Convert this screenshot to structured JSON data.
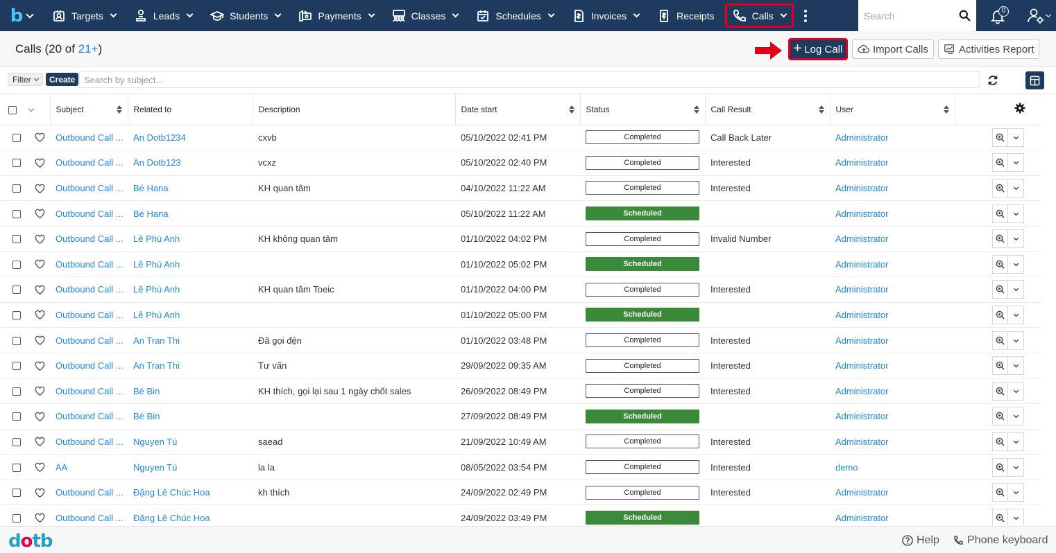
{
  "nav": {
    "items": [
      {
        "label": "Targets",
        "icon": "target-id-icon",
        "caret": true
      },
      {
        "label": "Leads",
        "icon": "leads-person-icon",
        "caret": true
      },
      {
        "label": "Students",
        "icon": "graduation-cap-icon",
        "caret": true
      },
      {
        "label": "Payments",
        "icon": "payment-icon",
        "caret": true
      },
      {
        "label": "Classes",
        "icon": "classes-icon",
        "caret": true
      },
      {
        "label": "Schedules",
        "icon": "calendar-check-icon",
        "caret": true
      },
      {
        "label": "Invoices",
        "icon": "invoice-icon",
        "caret": true
      },
      {
        "label": "Receipts",
        "icon": "receipt-icon",
        "caret": false
      },
      {
        "label": "Calls",
        "icon": "phone-icon",
        "caret": true,
        "active": true
      }
    ],
    "search_placeholder": "Search",
    "notification_count": "0"
  },
  "header": {
    "title_prefix": "Calls (20 of ",
    "title_count": "21+",
    "title_suffix": ")",
    "log_call_label": "Log Call",
    "import_calls_label": "Import Calls",
    "activities_report_label": "Activities Report"
  },
  "filter": {
    "filter_label": "Filter",
    "create_label": "Create",
    "search_placeholder": "Search by subject..."
  },
  "columns": [
    "Subject",
    "Related to",
    "Description",
    "Date start",
    "Status",
    "Call Result",
    "User"
  ],
  "rows": [
    {
      "subject": "Outbound Call ...",
      "related": "An Dotb1234",
      "description": "cxvb",
      "date": "05/10/2022 02:41 PM",
      "status": "Completed",
      "result": "Call Back Later",
      "user": "Administrator"
    },
    {
      "subject": "Outbound Call ...",
      "related": "An Dotb123",
      "description": "vcxz",
      "date": "05/10/2022 02:40 PM",
      "status": "Completed",
      "result": "Interested",
      "user": "Administrator"
    },
    {
      "subject": "Outbound Call ...",
      "related": "Bé Hana",
      "description": "KH quan tâm",
      "date": "04/10/2022 11:22 AM",
      "status": "Completed",
      "result": "Interested",
      "user": "Administrator"
    },
    {
      "subject": "Outbound Call ...",
      "related": "Bé Hana",
      "description": "",
      "date": "05/10/2022 11:22 AM",
      "status": "Scheduled",
      "result": "",
      "user": "Administrator"
    },
    {
      "subject": "Outbound Call ...",
      "related": "Lê Phú Anh",
      "description": "KH không quan tâm",
      "date": "01/10/2022 04:02 PM",
      "status": "Completed",
      "result": "Invalid Number",
      "user": "Administrator"
    },
    {
      "subject": "Outbound Call ...",
      "related": "Lê Phú Anh",
      "description": "",
      "date": "01/10/2022 05:02 PM",
      "status": "Scheduled",
      "result": "",
      "user": "Administrator"
    },
    {
      "subject": "Outbound Call ...",
      "related": "Lê Phú Anh",
      "description": "KH quan tâm Toeic",
      "date": "01/10/2022 04:00 PM",
      "status": "Completed",
      "result": "Interested",
      "user": "Administrator"
    },
    {
      "subject": "Outbound Call ...",
      "related": "Lê Phú Anh",
      "description": "",
      "date": "01/10/2022 05:00 PM",
      "status": "Scheduled",
      "result": "",
      "user": "Administrator"
    },
    {
      "subject": "Outbound Call ...",
      "related": "An Tran Thi",
      "description": "Đã gọi đện",
      "date": "01/10/2022 03:48 PM",
      "status": "Completed",
      "result": "Interested",
      "user": "Administrator"
    },
    {
      "subject": "Outbound Call ...",
      "related": "An Tran Thi",
      "description": "Tư vấn",
      "date": "29/09/2022 09:35 AM",
      "status": "Completed",
      "result": "Interested",
      "user": "Administrator"
    },
    {
      "subject": "Outbound Call ...",
      "related": "Bé Bin",
      "description": "KH thích, gọi lại sau 1 ngày chốt sales",
      "date": "26/09/2022 08:49 PM",
      "status": "Completed",
      "result": "Interested",
      "user": "Administrator"
    },
    {
      "subject": "Outbound Call ...",
      "related": "Bé Bin",
      "description": "",
      "date": "27/09/2022 08:49 PM",
      "status": "Scheduled",
      "result": "",
      "user": "Administrator"
    },
    {
      "subject": "Outbound Call ...",
      "related": "Nguyen Tú",
      "description": "saead",
      "date": "21/09/2022 10:49 AM",
      "status": "Completed",
      "result": "Interested",
      "user": "Administrator"
    },
    {
      "subject": "AA",
      "related": "Nguyen Tú",
      "description": "la la",
      "date": "08/05/2022 03:54 PM",
      "status": "Completed",
      "result": "Interested",
      "user": "demo"
    },
    {
      "subject": "Outbound Call ...",
      "related": "Đặng Lê Chúc Hoa",
      "description": "kh thích",
      "date": "24/09/2022 02:49 PM",
      "status": "Completed",
      "result": "Interested",
      "user": "Administrator"
    },
    {
      "subject": "Outbound Call ...",
      "related": "Đặng Lê Chúc Hoa",
      "description": "",
      "date": "24/09/2022 03:49 PM",
      "status": "Scheduled",
      "result": "",
      "user": "Administrator"
    }
  ],
  "footer": {
    "logo_text": "dotb",
    "help_label": "Help",
    "phone_keyboard_label": "Phone keyboard"
  },
  "colors": {
    "nav_bg": "#1e3a5f",
    "highlight_red": "#e3001b",
    "link_blue": "#1e88e5",
    "scheduled_green": "#3a8a3a"
  }
}
